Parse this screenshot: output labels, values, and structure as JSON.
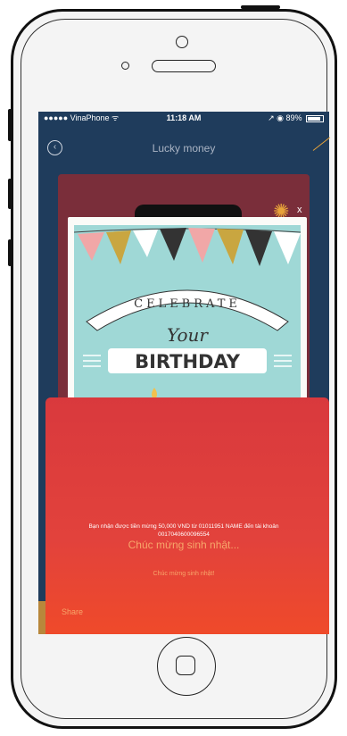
{
  "status_bar": {
    "carrier": "●●●●● VinaPhone ᯤ",
    "time": "11:18 AM",
    "battery": "↗ ◉ 89%"
  },
  "navbar": {
    "title": "Lucky money",
    "back_icon": "chevron-left-circle-icon"
  },
  "card": {
    "line1": "CELEBRATE",
    "line2": "Your",
    "line3": "BIRTHDAY"
  },
  "message": {
    "text": "Bạn nhận được tiền mừng 50,000 VND từ 01011951 NAME đến tài khoản 0017040600096554",
    "wish_main": "Chúc mừng sinh nhật...",
    "wish_small": "Chúc mừng sinh nhật!",
    "share_label": "Share"
  },
  "close_label": "x",
  "colors": {
    "screen_bg": "#1f3c5c",
    "envelope_red": "#e2423c",
    "accent_orange": "#f7a66a",
    "card_teal": "#9fd8d6"
  }
}
